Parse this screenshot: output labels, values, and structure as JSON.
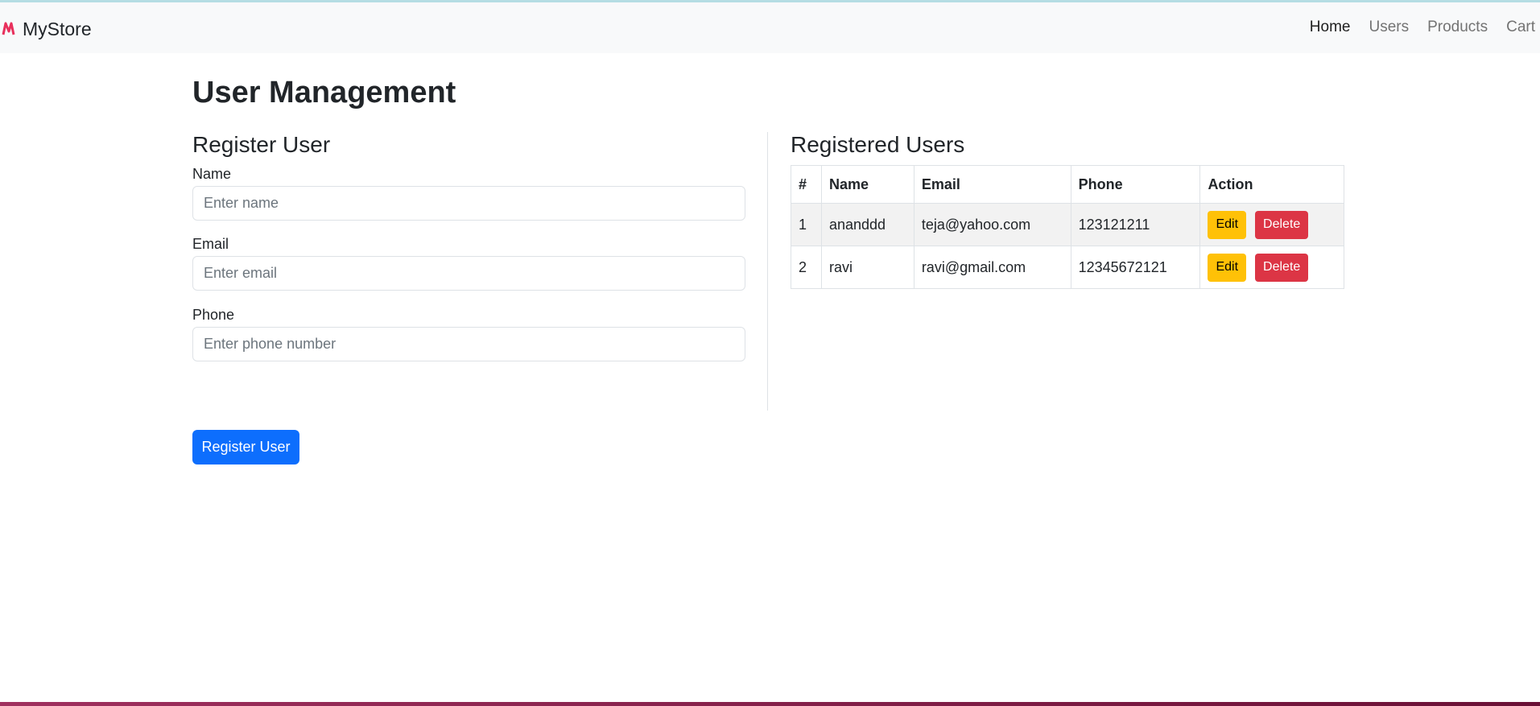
{
  "navbar": {
    "brand": "MyStore",
    "links": [
      "Home",
      "Users",
      "Products",
      "Cart"
    ]
  },
  "page": {
    "title": "User Management"
  },
  "register": {
    "title": "Register User",
    "name_label": "Name",
    "name_placeholder": "Enter name",
    "email_label": "Email",
    "email_placeholder": "Enter email",
    "phone_label": "Phone",
    "phone_placeholder": "Enter phone number",
    "submit_label": "Register User"
  },
  "users": {
    "title": "Registered Users",
    "headers": [
      "#",
      "Name",
      "Email",
      "Phone",
      "Action"
    ],
    "rows": [
      {
        "num": "1",
        "name": "ananddd",
        "email": "teja@yahoo.com",
        "phone": "123121211"
      },
      {
        "num": "2",
        "name": "ravi",
        "email": "ravi@gmail.com",
        "phone": "12345672121"
      }
    ],
    "edit_label": "Edit",
    "delete_label": "Delete"
  },
  "colors": {
    "primary": "#0d6efd",
    "warning": "#ffc107",
    "danger": "#dc3545"
  }
}
